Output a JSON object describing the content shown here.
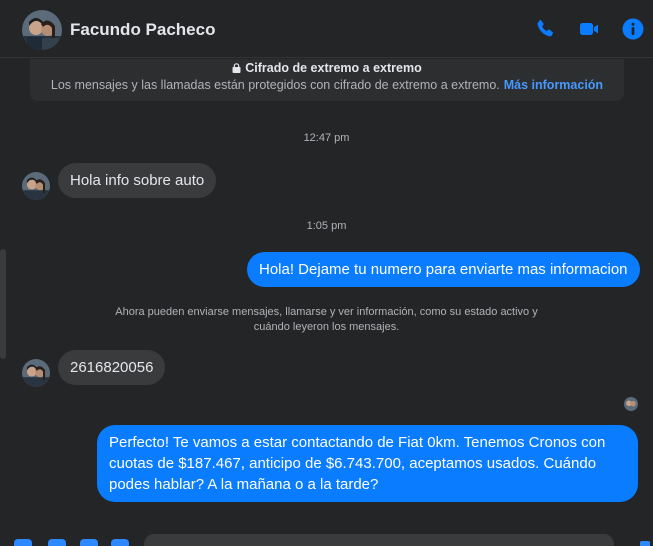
{
  "header": {
    "contact_name": "Facundo Pacheco",
    "icons": [
      "phone-icon",
      "video-camera-icon",
      "info-icon"
    ],
    "accent_color": "#0a7cff"
  },
  "encryption": {
    "title": "Cifrado de extremo a extremo",
    "text": "Los mensajes y las llamadas están protegidos con cifrado de extremo a extremo.",
    "link": "Más información"
  },
  "timeline": {
    "time_1": "12:47 pm",
    "msg_1": "Hola info sobre auto",
    "time_2": "1:05 pm",
    "msg_2": "Hola! Dejame tu numero para enviarte mas informacion",
    "system_note": "Ahora pueden enviarse mensajes, llamarse y ver información, como su estado activo y cuándo leyeron los mensajes.",
    "msg_3": "2616820056",
    "msg_4": "Perfecto! Te vamos a estar contactando de Fiat 0km. Tenemos Cronos con cuotas de $187.467, anticipo de $6.743.700, aceptamos usados. Cuándo podes hablar? A la mañana o a la tarde?"
  },
  "colors": {
    "background": "#242526",
    "incoming_bubble": "#3a3b3c",
    "outgoing_bubble": "#0a7cff",
    "link": "#4599ff"
  }
}
